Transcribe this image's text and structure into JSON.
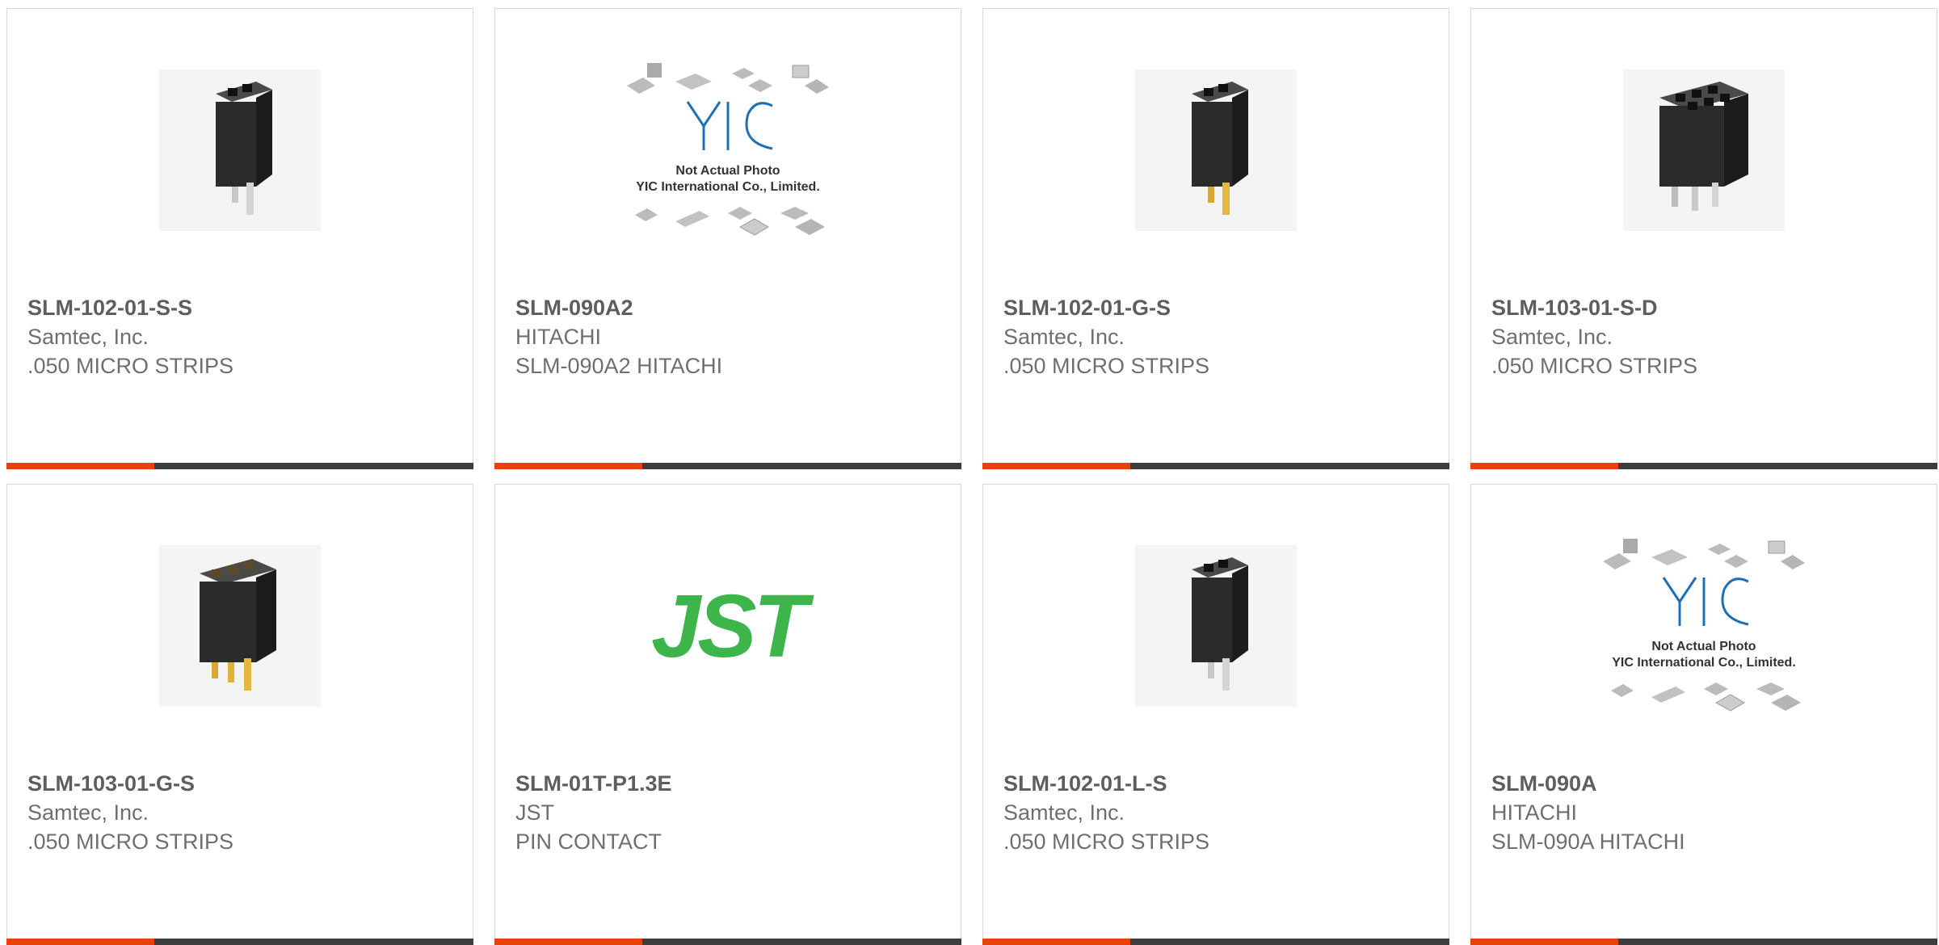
{
  "colors": {
    "accent": "#e8410e",
    "bar_dark": "#3d3d3d",
    "jst_green": "#3db54a"
  },
  "cards": [
    {
      "part_number": "SLM-102-01-S-S",
      "manufacturer": "Samtec, Inc.",
      "description": ".050 MICRO STRIPS",
      "image": "connector-2pin-silver-icon"
    },
    {
      "part_number": "SLM-090A2",
      "manufacturer": "HITACHI",
      "description": "SLM-090A2 HITACHI",
      "image": "yic-placeholder-icon",
      "placeholder_line1": "Not Actual Photo",
      "placeholder_line2": "YIC International Co., Limited."
    },
    {
      "part_number": "SLM-102-01-G-S",
      "manufacturer": "Samtec, Inc.",
      "description": ".050 MICRO STRIPS",
      "image": "connector-2pin-gold-icon"
    },
    {
      "part_number": "SLM-103-01-S-D",
      "manufacturer": "Samtec, Inc.",
      "description": ".050 MICRO STRIPS",
      "image": "connector-6pin-silver-icon"
    },
    {
      "part_number": "SLM-103-01-G-S",
      "manufacturer": "Samtec, Inc.",
      "description": ".050 MICRO STRIPS",
      "image": "connector-3pin-gold-icon"
    },
    {
      "part_number": "SLM-01T-P1.3E",
      "manufacturer": "JST",
      "description": "PIN CONTACT",
      "image": "jst-logo",
      "logo_text": "JST"
    },
    {
      "part_number": "SLM-102-01-L-S",
      "manufacturer": "Samtec, Inc.",
      "description": ".050 MICRO STRIPS",
      "image": "connector-2pin-silver-icon"
    },
    {
      "part_number": "SLM-090A",
      "manufacturer": "HITACHI",
      "description": "SLM-090A HITACHI",
      "image": "yic-placeholder-icon",
      "placeholder_line1": "Not Actual Photo",
      "placeholder_line2": "YIC International Co., Limited."
    }
  ]
}
